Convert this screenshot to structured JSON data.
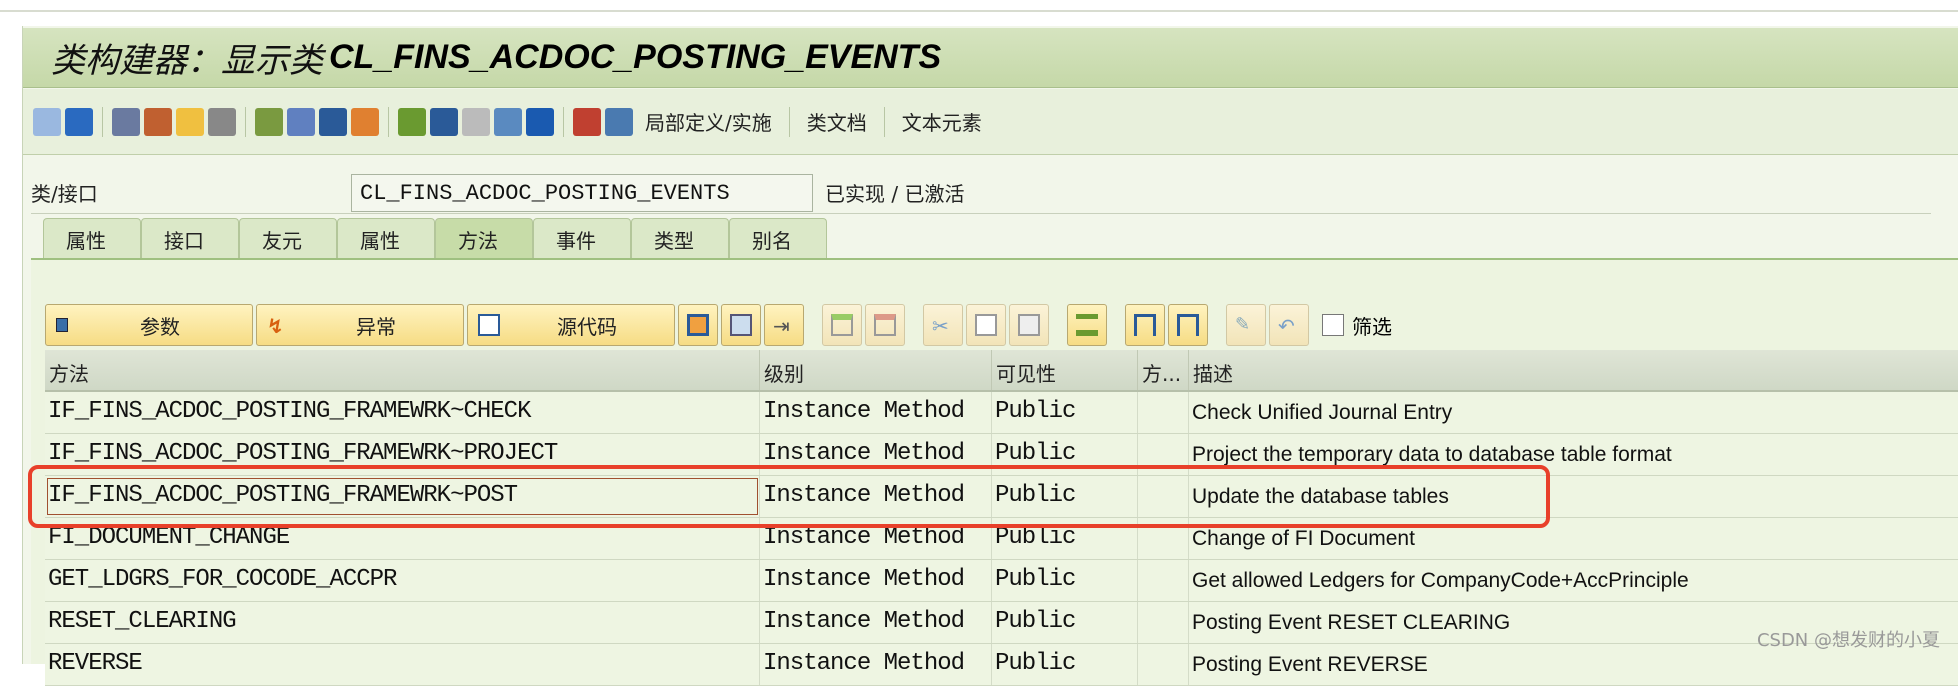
{
  "title": {
    "prefix": "类构建器：显示类",
    "class_name": "CL_FINS_ACDOC_POSTING_EVENTS"
  },
  "toolbar": {
    "icons": [
      "back-icon",
      "forward-icon",
      "other-object-icon",
      "display-change-icon",
      "activate-icon",
      "where-used-icon",
      "object-list-icon",
      "magic-wand-icon",
      "clamp-icon",
      "navigate-icon",
      "hierarchy-icon",
      "stack-icon",
      "list-icon",
      "filter-icon",
      "info-icon",
      "local-types-icon",
      "document-icon"
    ],
    "local_def": "局部定义/实施",
    "class_doc": "类文档",
    "text_elements": "文本元素"
  },
  "class_field": {
    "label": "类/接口",
    "value": "CL_FINS_ACDOC_POSTING_EVENTS",
    "status": "已实现 / 已激活"
  },
  "tabs": [
    {
      "label": "属性"
    },
    {
      "label": "接口"
    },
    {
      "label": "友元"
    },
    {
      "label": "属性"
    },
    {
      "label": "方法",
      "active": true
    },
    {
      "label": "事件"
    },
    {
      "label": "类型"
    },
    {
      "label": "别名"
    }
  ],
  "buttons": {
    "params": "参数",
    "exceptions": "异常",
    "source": "源代码",
    "filter": "筛选"
  },
  "table": {
    "headers": [
      "方法",
      "级别",
      "可见性",
      "方...",
      "描述"
    ],
    "rows": [
      [
        "IF_FINS_ACDOC_POSTING_FRAMEWRK~CHECK",
        "Instance Method",
        "Public",
        "",
        "Check Unified Journal Entry"
      ],
      [
        "IF_FINS_ACDOC_POSTING_FRAMEWRK~PROJECT",
        "Instance Method",
        "Public",
        "",
        "Project the temporary data to database table format"
      ],
      [
        "IF_FINS_ACDOC_POSTING_FRAMEWRK~POST",
        "Instance Method",
        "Public",
        "",
        "Update the database tables"
      ],
      [
        "FI_DOCUMENT_CHANGE",
        "Instance Method",
        "Public",
        "",
        "Change of FI Document"
      ],
      [
        "GET_LDGRS_FOR_COCODE_ACCPR",
        "Instance Method",
        "Public",
        "",
        "Get allowed Ledgers for CompanyCode+AccPrinciple"
      ],
      [
        "RESET_CLEARING",
        "Instance Method",
        "Public",
        "",
        "Posting Event RESET CLEARING"
      ],
      [
        "REVERSE",
        "Instance Method",
        "Public",
        "",
        "Posting Event REVERSE"
      ]
    ],
    "selected_row": 2
  },
  "highlight_color": "#e8402a",
  "watermark": "CSDN @想发财的小夏"
}
